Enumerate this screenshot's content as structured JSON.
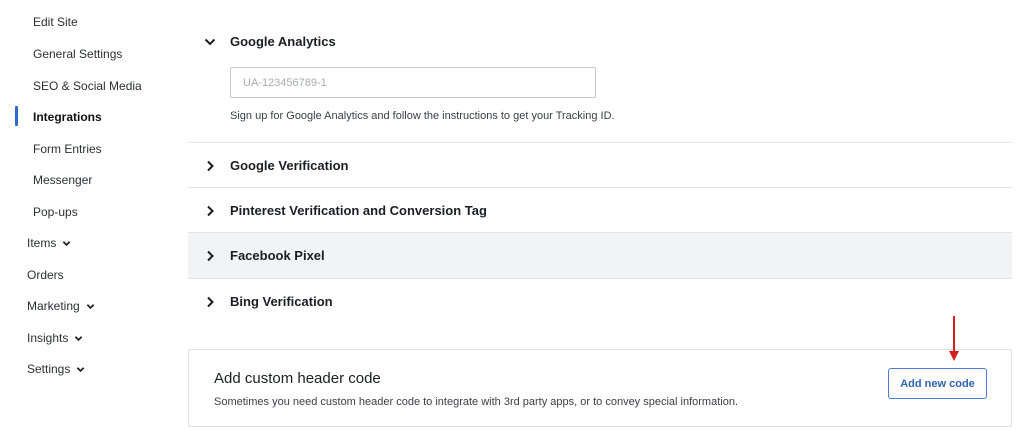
{
  "sidebar": {
    "items": [
      {
        "label": "Edit Site"
      },
      {
        "label": "General Settings"
      },
      {
        "label": "SEO & Social Media"
      },
      {
        "label": "Integrations"
      },
      {
        "label": "Form Entries"
      },
      {
        "label": "Messenger"
      },
      {
        "label": "Pop-ups"
      },
      {
        "label": "Items"
      },
      {
        "label": "Orders"
      },
      {
        "label": "Marketing"
      },
      {
        "label": "Insights"
      },
      {
        "label": "Settings"
      }
    ]
  },
  "integrations": {
    "google_analytics": {
      "title": "Google Analytics",
      "input_placeholder": "UA-123456789-1",
      "help": "Sign up for Google Analytics and follow the instructions to get your Tracking ID."
    },
    "google_verification": {
      "title": "Google Verification"
    },
    "pinterest": {
      "title": "Pinterest Verification and Conversion Tag"
    },
    "facebook_pixel": {
      "title": "Facebook Pixel"
    },
    "bing": {
      "title": "Bing Verification"
    }
  },
  "custom_header": {
    "title": "Add custom header code",
    "description": "Sometimes you need custom header code to integrate with 3rd party apps, or to convey special information.",
    "button_label": "Add new code"
  },
  "colors": {
    "accent": "#2e6bd4",
    "hover_row": "#f2f3f5",
    "annotation_arrow": "#d6201f"
  }
}
